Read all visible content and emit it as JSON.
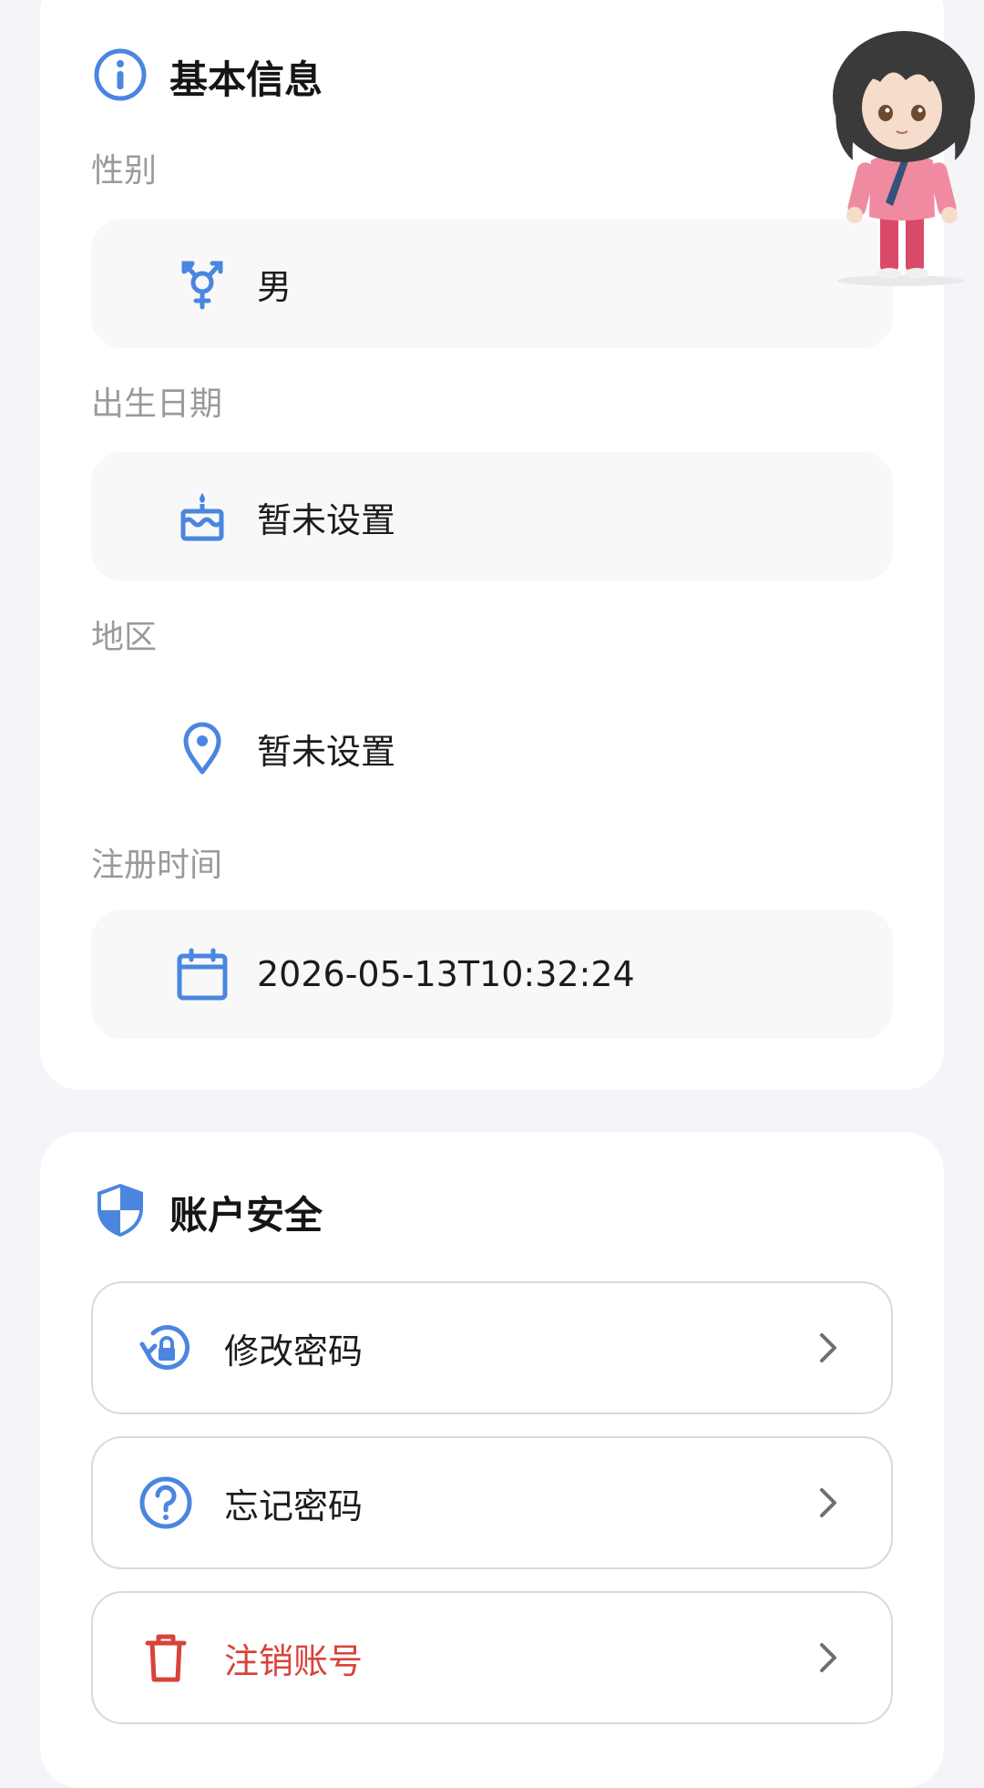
{
  "basic_info": {
    "title": "基本信息",
    "fields": [
      {
        "label": "性别",
        "value": "男",
        "icon": "gender-icon"
      },
      {
        "label": "出生日期",
        "value": "暂未设置",
        "icon": "cake-icon"
      },
      {
        "label": "地区",
        "value": "暂未设置",
        "icon": "location-pin-icon"
      },
      {
        "label": "注册时间",
        "value": "2026-05-13T10:32:24",
        "icon": "calendar-icon"
      }
    ]
  },
  "security": {
    "title": "账户安全",
    "actions": [
      {
        "label": "修改密码",
        "icon": "lock-reset-icon"
      },
      {
        "label": "忘记密码",
        "icon": "question-circle-icon"
      },
      {
        "label": "注销账号",
        "icon": "trash-icon"
      }
    ]
  },
  "colors": {
    "accent": "#4a86e0",
    "danger": "#d8433a",
    "background": "#f4f4f9",
    "card": "#ffffff",
    "field_bg": "#f8f8f9",
    "muted_text": "#9a9a9a"
  }
}
